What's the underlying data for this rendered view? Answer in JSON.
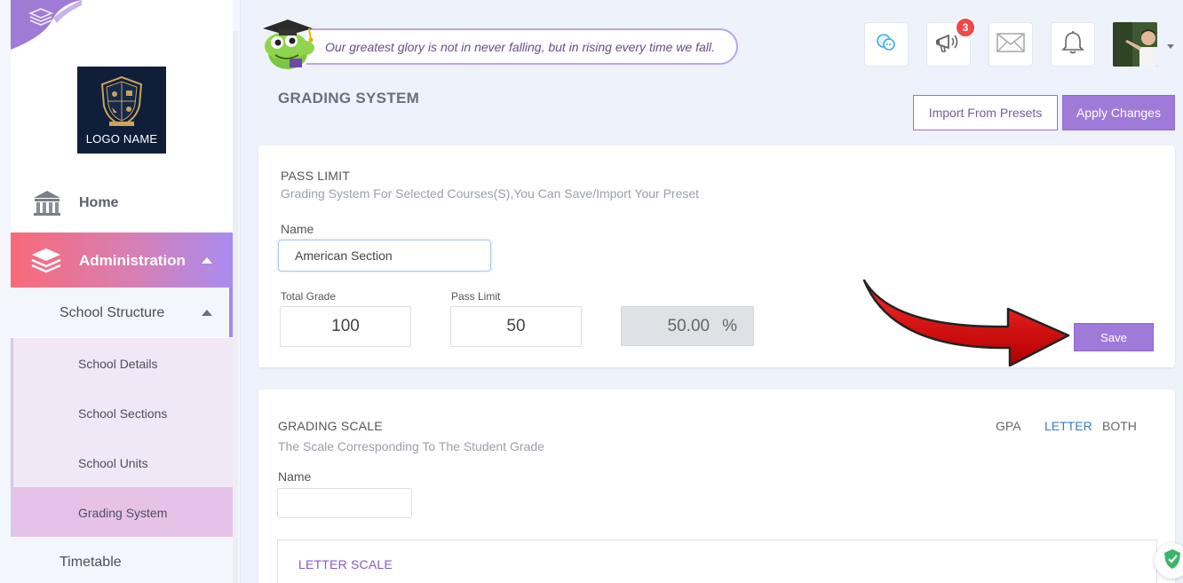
{
  "sidebar": {
    "logo_text": "LOGO NAME",
    "home_label": "Home",
    "admin_label": "Administration",
    "structure_label": "School Structure",
    "sub_items": [
      "School Details",
      "School Sections",
      "School Units",
      "Grading System"
    ],
    "timetable_label": "Timetable"
  },
  "header": {
    "quote": "Our greatest glory is not in never falling, but in rising every time we fall.",
    "notification_count": "3",
    "icons": [
      "chat-icon",
      "megaphone-icon",
      "mail-icon",
      "bell-icon"
    ]
  },
  "page": {
    "title": "GRADING SYSTEM",
    "import_label": "Import From Presets",
    "apply_label": "Apply Changes"
  },
  "pass_limit": {
    "title": "PASS LIMIT",
    "subtitle": "Grading System For Selected Courses(S),You Can Save/Import Your Preset",
    "name_label": "Name",
    "name_value": "American Section",
    "total_grade_label": "Total Grade",
    "total_grade_value": "100",
    "pass_limit_label": "Pass Limit",
    "pass_limit_value": "50",
    "percent_value": "50.00",
    "percent_sign": "%",
    "save_label": "Save"
  },
  "grading_scale": {
    "title": "GRADING SCALE",
    "subtitle": "The Scale Corresponding To The Student Grade",
    "tabs": [
      "GPA",
      "LETTER",
      "BOTH"
    ],
    "active_tab": "LETTER",
    "name_label": "Name",
    "letter_scale_label": "LETTER SCALE"
  },
  "colors": {
    "accent": "#a07ad9",
    "admin_gradient_start": "#f86a78",
    "admin_gradient_end": "#a98cf0",
    "badge": "#f04848",
    "arrow": "#d40000"
  }
}
